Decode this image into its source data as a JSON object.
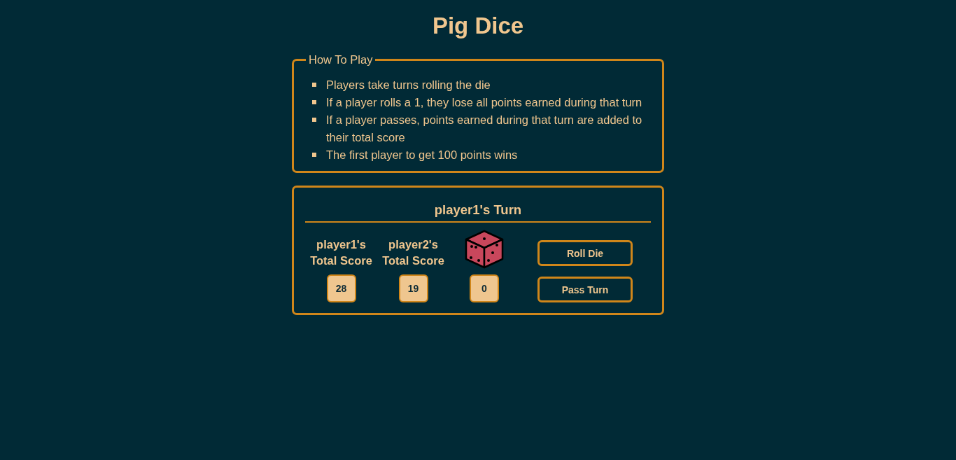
{
  "title": "Pig Dice",
  "how_to_play": {
    "legend": "How To Play",
    "rules": [
      "Players take turns rolling the die",
      "If a player rolls a 1, they lose all points earned during that turn",
      "If a player passes, points earned during that turn are added to their total score",
      "The first player to get 100 points wins"
    ]
  },
  "game": {
    "turn_heading": "player1's Turn",
    "players": [
      {
        "label": "player1's Total Score",
        "score": "28"
      },
      {
        "label": "player2's Total Score",
        "score": "19"
      }
    ],
    "turn_points": "0",
    "buttons": [
      "Roll Die",
      "Pass Turn"
    ]
  }
}
